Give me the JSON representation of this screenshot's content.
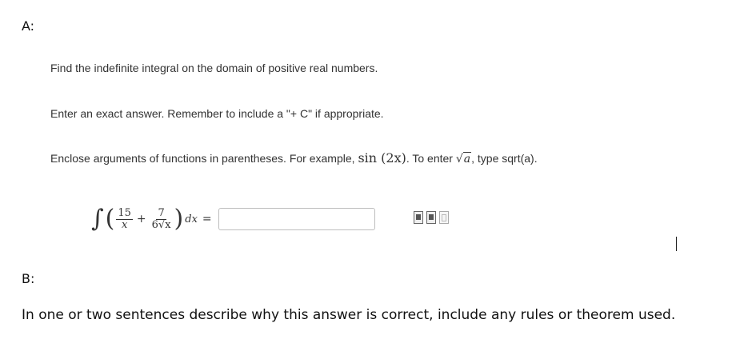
{
  "labels": {
    "a": "A:",
    "b": "B:"
  },
  "instructions": {
    "line1": "Find the indefinite integral on the domain of positive real numbers.",
    "line2": "Enter an exact answer. Remember to include a \"+ C\" if appropriate.",
    "line3_prefix": "Enclose arguments of functions in parentheses. For example,",
    "line3_example": "sin (2x)",
    "line3_middle": ". To enter",
    "line3_sqrt_var": "a",
    "line3_suffix": ", type sqrt(a)."
  },
  "integral": {
    "sign": "∫",
    "frac1": {
      "numerator": "15",
      "denominator": "x"
    },
    "frac2": {
      "numerator": "7",
      "denominator": "6√x"
    },
    "plus": "+",
    "differential": "dx",
    "equals": "="
  },
  "answer": {
    "value": "",
    "placeholder": ""
  },
  "tools": [
    "templates-icon",
    "insert-icon",
    "preview-icon"
  ],
  "question_b": "In one or two sentences describe why this answer is correct, include any rules or theorem used."
}
